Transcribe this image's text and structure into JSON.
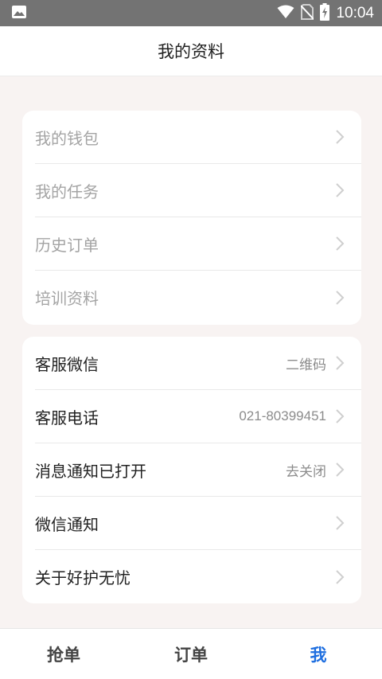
{
  "status_bar": {
    "time": "10:04",
    "icons": [
      "image-icon",
      "wifi-icon",
      "no-sim-icon",
      "battery-charging-icon"
    ]
  },
  "header": {
    "title": "我的资料"
  },
  "menu_group_1": [
    {
      "label": "我的钱包"
    },
    {
      "label": "我的任务"
    },
    {
      "label": "历史订单"
    },
    {
      "label": "培训资料"
    }
  ],
  "menu_group_2": [
    {
      "label": "客服微信",
      "value": "二维码"
    },
    {
      "label": "客服电话",
      "value": "021-80399451"
    },
    {
      "label": "消息通知已打开",
      "value": "去关闭"
    },
    {
      "label": "微信通知",
      "value": ""
    },
    {
      "label": "关于好护无忧",
      "value": ""
    }
  ],
  "tabs": [
    {
      "label": "抢单",
      "active": false
    },
    {
      "label": "订单",
      "active": false
    },
    {
      "label": "我",
      "active": true
    }
  ],
  "colors": {
    "accent": "#1f6fe0",
    "status_bar": "#737373",
    "background": "#f8f3f2"
  }
}
